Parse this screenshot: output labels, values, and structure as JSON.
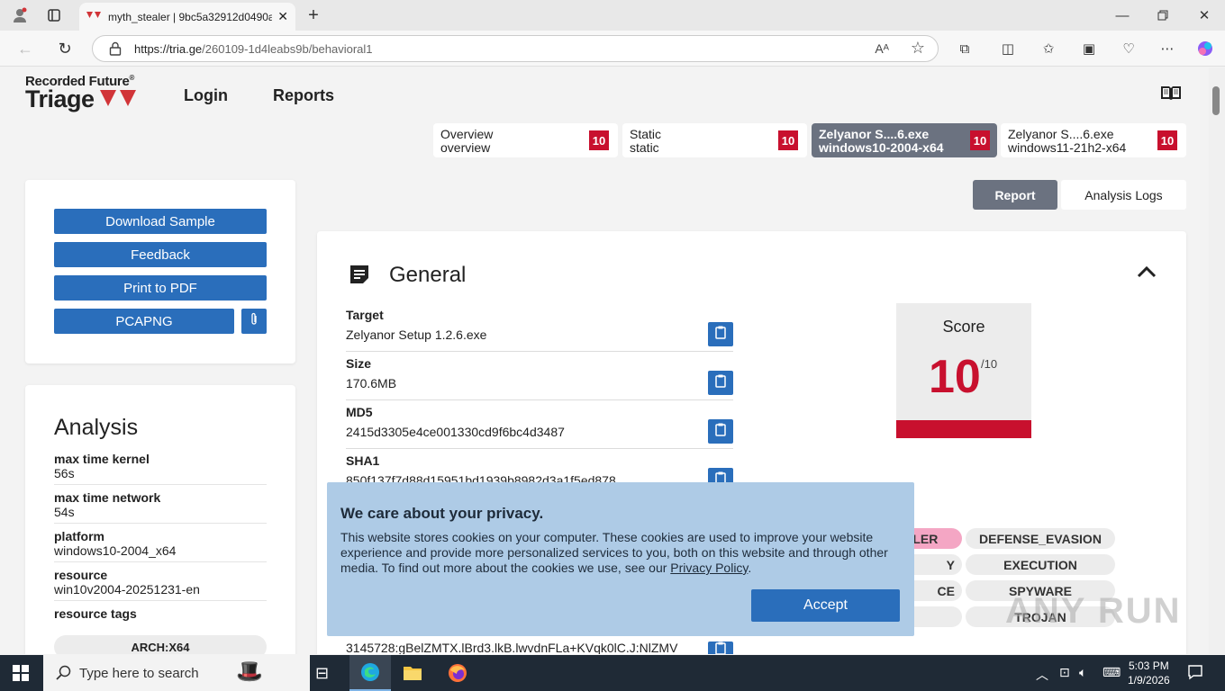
{
  "browser": {
    "tab_title": "myth_stealer | 9bc5a32912d0490a",
    "url_host": "https://tria.ge",
    "url_path": "/260109-1d4leabs9b/behavioral1"
  },
  "header": {
    "logo_top": "Recorded Future",
    "logo_registered": "®",
    "logo_bottom": "Triage",
    "nav": [
      "Login",
      "Reports"
    ]
  },
  "report_tabs": [
    {
      "line1": "Overview",
      "line2": "overview",
      "score": "10",
      "active": false
    },
    {
      "line1": "Static",
      "line2": "static",
      "score": "10",
      "active": false
    },
    {
      "line1": "Zelyanor S....6.exe",
      "line2": "windows10-2004-x64",
      "score": "10",
      "active": true
    },
    {
      "line1": "Zelyanor S....6.exe",
      "line2": "windows11-21h2-x64",
      "score": "10",
      "active": false
    }
  ],
  "view_toggle": {
    "report": "Report",
    "logs": "Analysis Logs"
  },
  "actions": {
    "download": "Download Sample",
    "feedback": "Feedback",
    "print": "Print to PDF",
    "pcapng": "PCAPNG"
  },
  "analysis": {
    "title": "Analysis",
    "rows": [
      {
        "label": "max time kernel",
        "value": "56s"
      },
      {
        "label": "max time network",
        "value": "54s"
      },
      {
        "label": "platform",
        "value": "windows10-2004_x64"
      },
      {
        "label": "resource",
        "value": "win10v2004-20251231-en"
      },
      {
        "label": "resource tags",
        "value": ""
      }
    ],
    "resource_tag": "ARCH:X64"
  },
  "general": {
    "title": "General",
    "fields": [
      {
        "label": "Target",
        "value": "Zelyanor Setup 1.2.6.exe"
      },
      {
        "label": "Size",
        "value": "170.6MB"
      },
      {
        "label": "MD5",
        "value": "2415d3305e4ce001330cd9f6bc4d3487"
      },
      {
        "label": "SHA1",
        "value": "850f137f7d88d15951bd1939b8982d3a1f5ed878"
      }
    ],
    "partial_value": "3145728:gBelZMTX.lBrd3.lkB.lwvdnFLa+KVqk0lC.J:NlZMV",
    "score_label": "Score",
    "score_value": "10",
    "score_max": "/10",
    "tags": [
      "MYTH_STEALER",
      "DEFENSE_EVASION",
      "Y",
      "EXECUTION",
      "CE",
      "SPYWARE",
      "TROJAN"
    ]
  },
  "cookie": {
    "title": "We care about your privacy.",
    "text": "This website stores cookies on your computer. These cookies are used to improve your website experience and provide more personalized services to you, both on this website and through other media. To find out more about the cookies we use, see our",
    "link": "Privacy Policy",
    "period": ".",
    "accept": "Accept"
  },
  "taskbar": {
    "search_placeholder": "Type here to search",
    "time": "5:03 PM",
    "date": "1/9/2026"
  },
  "watermark": "ANY RUN",
  "colors": {
    "accent": "#2a6ebb",
    "score_red": "#c8102e",
    "cookie_bg": "#aecbe6",
    "tag_pink": "#f4a6c4"
  }
}
